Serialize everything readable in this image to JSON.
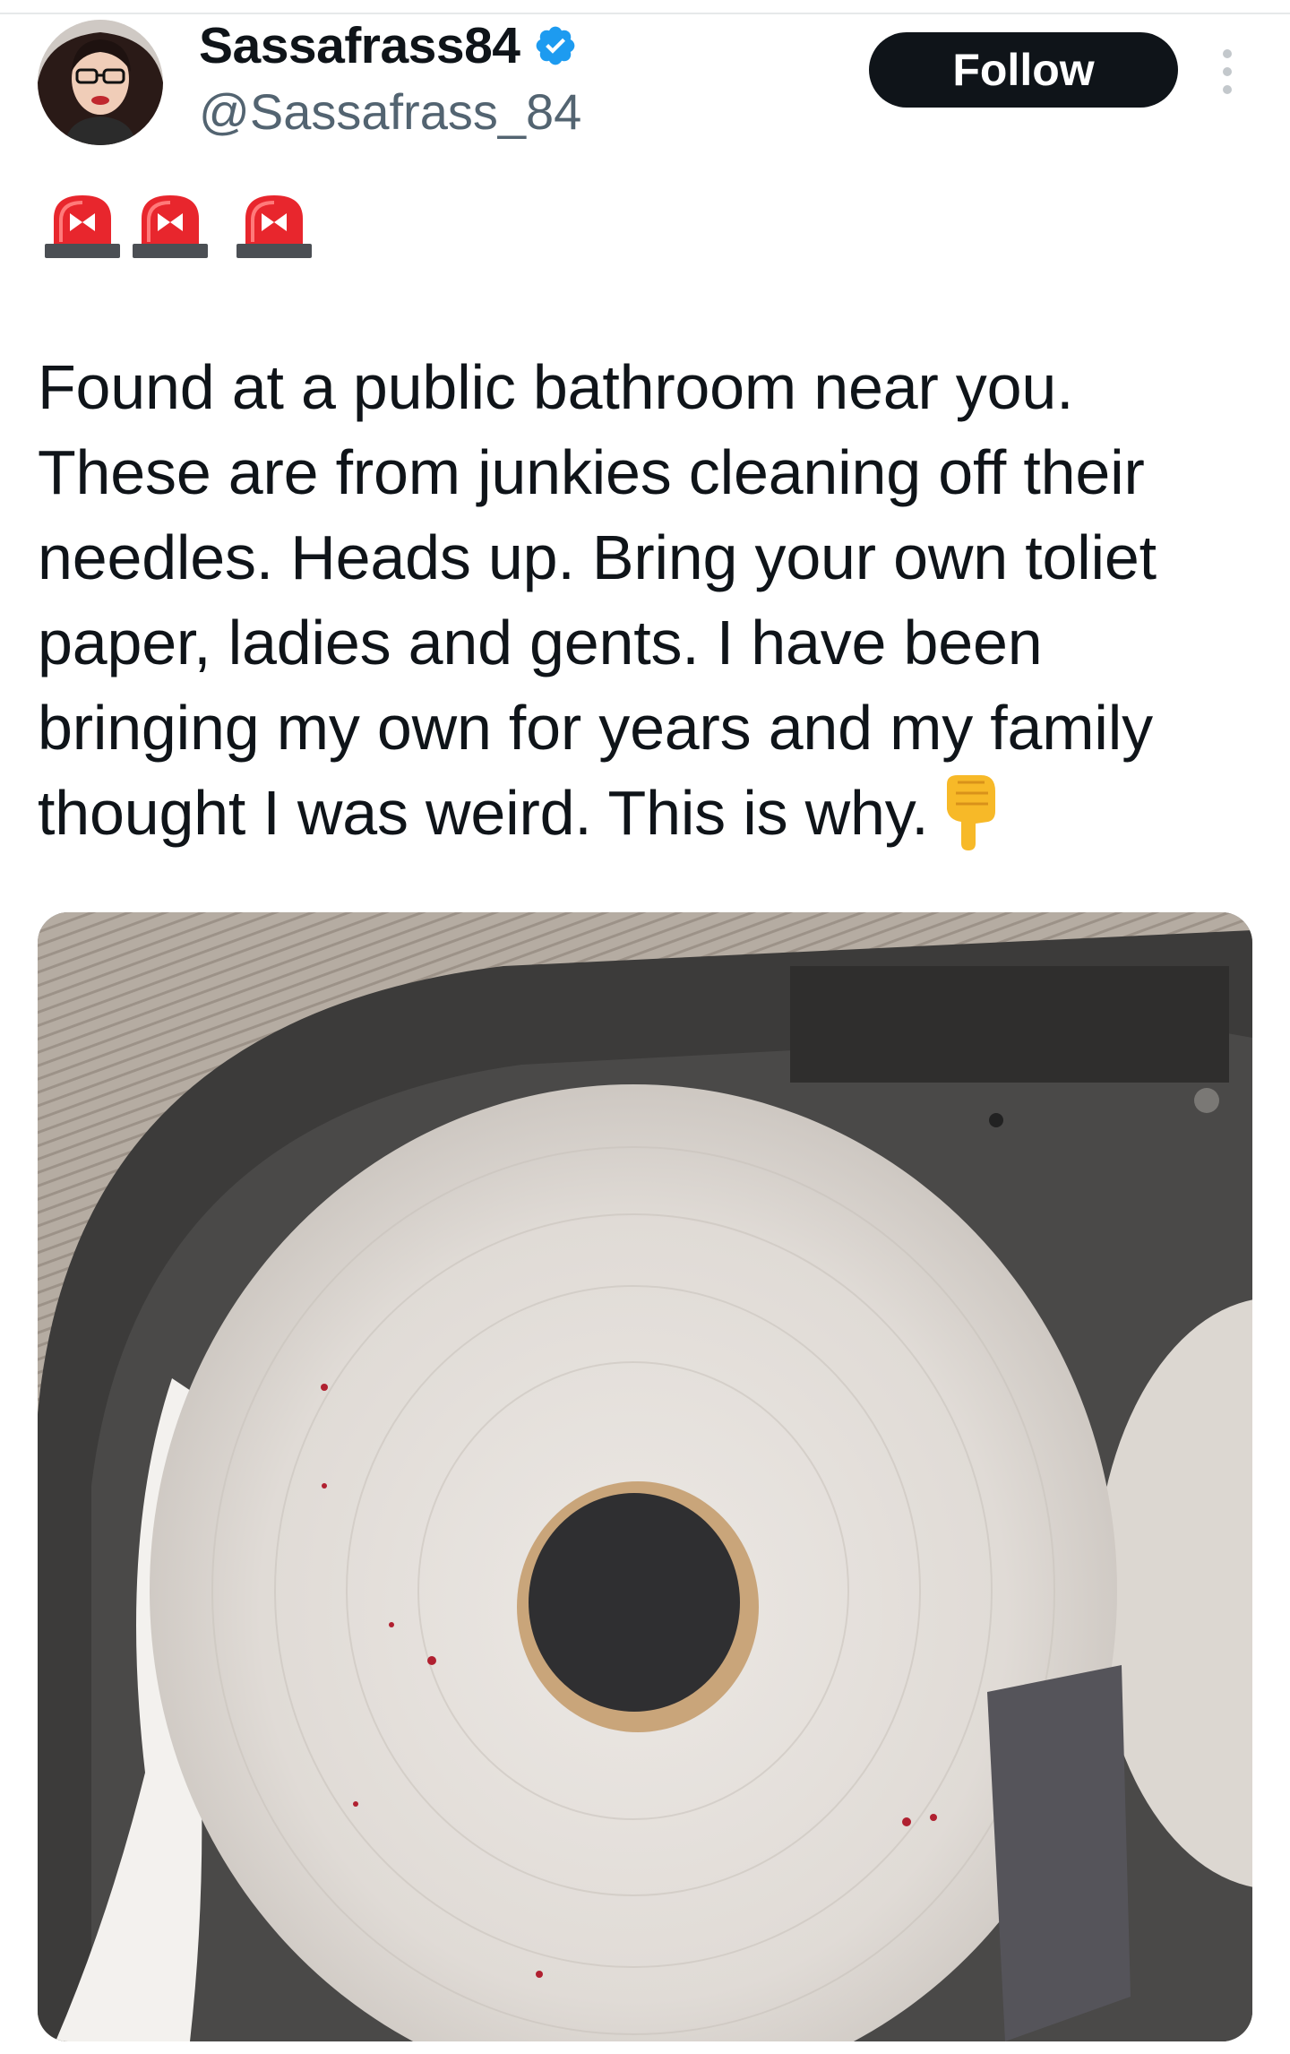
{
  "tweet": {
    "author": {
      "display_name": "Sassafrass84",
      "handle": "@Sassafrass_84",
      "verified": true,
      "verified_icon": "verified-badge-icon",
      "verified_color": "#1d9bf0"
    },
    "follow_label": "Follow",
    "more_icon": "more-vertical-icon",
    "emojis": [
      "siren-icon",
      "siren-icon",
      "siren-icon"
    ],
    "text": "Found at a public bathroom near you.\nThese are from junkies cleaning off their\nneedles. Heads up. Bring your own toliet\npaper, ladies and gents. I have been\nbringing my own for years and my family\nthought I was weird. This is why.",
    "trailing_emoji": "pointing-down-hand-icon",
    "media_icon": "toilet-paper-roll-photo"
  },
  "colors": {
    "text": "#0f1419",
    "secondary_text": "#536471",
    "follow_button_bg": "#0f1419",
    "follow_button_text": "#ffffff",
    "siren_red": "#e8262d",
    "hand_yellow": "#f7b928"
  }
}
